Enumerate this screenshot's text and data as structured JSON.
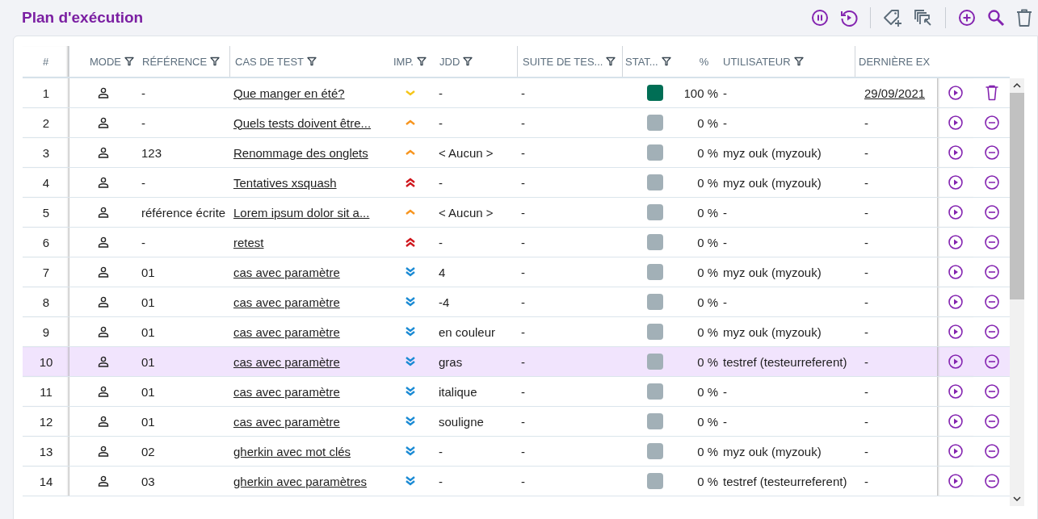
{
  "title": "Plan d'exécution",
  "columns": [
    {
      "label": "#",
      "filterable": false
    },
    {
      "label": "MODE",
      "filterable": true
    },
    {
      "label": "RÉFÉRENCE",
      "filterable": true
    },
    {
      "label": "CAS DE TEST",
      "filterable": true
    },
    {
      "label": "IMP.",
      "filterable": true
    },
    {
      "label": "JDD",
      "filterable": true
    },
    {
      "label": "SUITE DE TES...",
      "filterable": true
    },
    {
      "label": "STAT...",
      "filterable": true
    },
    {
      "label": "%",
      "filterable": false
    },
    {
      "label": "UTILISATEUR",
      "filterable": true
    },
    {
      "label": "DERNIÈRE EX",
      "filterable": false
    }
  ],
  "rows": [
    {
      "index": "1",
      "reference": "-",
      "test_case": "Que manger en été?",
      "importance": {
        "kind": "low"
      },
      "dataset": "-",
      "suite": "-",
      "color": "#006e55",
      "percent": "100 %",
      "user": "-",
      "last_execution": "29/09/2021",
      "end_action": {
        "kind": "delete"
      },
      "selected": false
    },
    {
      "index": "2",
      "reference": "-",
      "test_case": "Quels tests doivent être...",
      "importance": {
        "kind": "medium"
      },
      "dataset": "-",
      "suite": "-",
      "color": "#a2b0b7",
      "percent": "0 %",
      "user": "-",
      "last_execution": "-",
      "end_action": {
        "kind": "remove"
      },
      "selected": false
    },
    {
      "index": "3",
      "reference": "123",
      "test_case": "Renommage des onglets",
      "importance": {
        "kind": "medium"
      },
      "dataset": "< Aucun >",
      "suite": "-",
      "color": "#a2b0b7",
      "percent": "0 %",
      "user": "myz ouk (myzouk)",
      "last_execution": "-",
      "end_action": {
        "kind": "remove"
      },
      "selected": false
    },
    {
      "index": "4",
      "reference": "-",
      "test_case": "Tentatives xsquash",
      "importance": {
        "kind": "high"
      },
      "dataset": "-",
      "suite": "-",
      "color": "#a2b0b7",
      "percent": "0 %",
      "user": "myz ouk (myzouk)",
      "last_execution": "-",
      "end_action": {
        "kind": "remove"
      },
      "selected": false
    },
    {
      "index": "5",
      "reference": "référence écrite",
      "test_case": "Lorem ipsum dolor sit a...",
      "importance": {
        "kind": "medium"
      },
      "dataset": "< Aucun >",
      "suite": "-",
      "color": "#a2b0b7",
      "percent": "0 %",
      "user": "-",
      "last_execution": "-",
      "end_action": {
        "kind": "remove"
      },
      "selected": false
    },
    {
      "index": "6",
      "reference": "-",
      "test_case": "retest",
      "importance": {
        "kind": "high"
      },
      "dataset": "-",
      "suite": "-",
      "color": "#a2b0b7",
      "percent": "0 %",
      "user": "-",
      "last_execution": "-",
      "end_action": {
        "kind": "remove"
      },
      "selected": false
    },
    {
      "index": "7",
      "reference": "01",
      "test_case": "cas avec paramètre",
      "importance": {
        "kind": "very_low"
      },
      "dataset": "4",
      "suite": "-",
      "color": "#a2b0b7",
      "percent": "0 %",
      "user": "myz ouk (myzouk)",
      "last_execution": "-",
      "end_action": {
        "kind": "remove"
      },
      "selected": false
    },
    {
      "index": "8",
      "reference": "01",
      "test_case": "cas avec paramètre",
      "importance": {
        "kind": "very_low"
      },
      "dataset": "-4",
      "suite": "-",
      "color": "#a2b0b7",
      "percent": "0 %",
      "user": "-",
      "last_execution": "-",
      "end_action": {
        "kind": "remove"
      },
      "selected": false
    },
    {
      "index": "9",
      "reference": "01",
      "test_case": "cas avec paramètre",
      "importance": {
        "kind": "very_low"
      },
      "dataset": "en couleur",
      "suite": "-",
      "color": "#a2b0b7",
      "percent": "0 %",
      "user": "myz ouk (myzouk)",
      "last_execution": "-",
      "end_action": {
        "kind": "remove"
      },
      "selected": false
    },
    {
      "index": "10",
      "reference": "01",
      "test_case": "cas avec paramètre",
      "importance": {
        "kind": "very_low"
      },
      "dataset": "gras",
      "suite": "-",
      "color": "#a2b0b7",
      "percent": "0 %",
      "user": "testref (testeurreferent)",
      "last_execution": "-",
      "end_action": {
        "kind": "remove"
      },
      "selected": true
    },
    {
      "index": "11",
      "reference": "01",
      "test_case": "cas avec paramètre",
      "importance": {
        "kind": "very_low"
      },
      "dataset": "italique",
      "suite": "-",
      "color": "#a2b0b7",
      "percent": "0 %",
      "user": "-",
      "last_execution": "-",
      "end_action": {
        "kind": "remove"
      },
      "selected": false
    },
    {
      "index": "12",
      "reference": "01",
      "test_case": "cas avec paramètre",
      "importance": {
        "kind": "very_low"
      },
      "dataset": "souligne",
      "suite": "-",
      "color": "#a2b0b7",
      "percent": "0 %",
      "user": "-",
      "last_execution": "-",
      "end_action": {
        "kind": "remove"
      },
      "selected": false
    },
    {
      "index": "13",
      "reference": "02",
      "test_case": "gherkin avec mot clés",
      "importance": {
        "kind": "very_low"
      },
      "dataset": "-",
      "suite": "-",
      "color": "#a2b0b7",
      "percent": "0 %",
      "user": "myz ouk (myzouk)",
      "last_execution": "-",
      "end_action": {
        "kind": "remove"
      },
      "selected": false
    },
    {
      "index": "14",
      "reference": "03",
      "test_case": "gherkin avec paramètres",
      "importance": {
        "kind": "very_low"
      },
      "dataset": "-",
      "suite": "-",
      "color": "#a2b0b7",
      "percent": "0 %",
      "user": "testref (testeurreferent)",
      "last_execution": "-",
      "end_action": {
        "kind": "remove"
      },
      "selected": false
    }
  ]
}
